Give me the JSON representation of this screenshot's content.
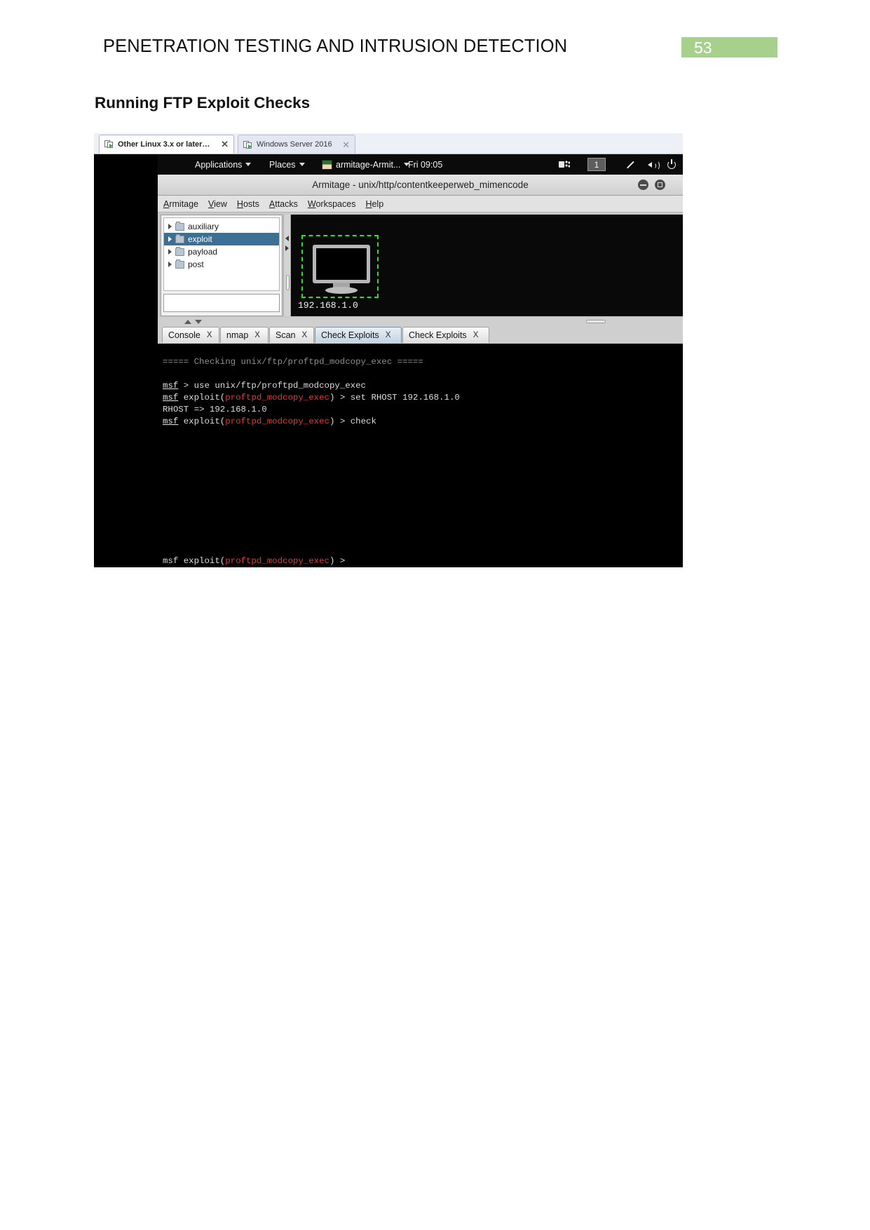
{
  "document": {
    "header_title": "PENETRATION TESTING AND INTRUSION DETECTION",
    "page_number": "53",
    "section_heading": "Running FTP Exploit Checks",
    "badge_color": "#a8d08d"
  },
  "vm_tabs": [
    {
      "label": "Other Linux 3.x or later ke...",
      "close": "✕",
      "active": true
    },
    {
      "label": "Windows Server 2016",
      "close": "✕",
      "active": false
    }
  ],
  "gnome_panel": {
    "applications": "Applications",
    "places": "Places",
    "window_menu": "armitage-Armit...",
    "clock": "Fri 09:05",
    "workspace": "1"
  },
  "armitage": {
    "window_title": "Armitage - unix/http/contentkeeperweb_mimencode",
    "menu": [
      {
        "pre": "",
        "mnemonic": "A",
        "post": "rmitage"
      },
      {
        "pre": "",
        "mnemonic": "V",
        "post": "iew"
      },
      {
        "pre": "",
        "mnemonic": "H",
        "post": "osts"
      },
      {
        "pre": "",
        "mnemonic": "A",
        "post": "ttacks"
      },
      {
        "pre": "",
        "mnemonic": "W",
        "post": "orkspaces"
      },
      {
        "pre": "",
        "mnemonic": "H",
        "post": "elp"
      }
    ],
    "module_tree": [
      {
        "label": "auxiliary",
        "selected": false
      },
      {
        "label": "exploit",
        "selected": true
      },
      {
        "label": "payload",
        "selected": false
      },
      {
        "label": "post",
        "selected": false
      }
    ],
    "module_search_value": "",
    "host": {
      "ip": "192.168.1.0",
      "selected": true
    },
    "console_tabs": [
      {
        "label": "Console",
        "close": "X",
        "active": false
      },
      {
        "label": "nmap",
        "close": "X",
        "active": false
      },
      {
        "label": "Scan",
        "close": "X",
        "active": false
      },
      {
        "label": "Check Exploits",
        "close": "X",
        "active": true
      },
      {
        "label": "Check Exploits",
        "close": "X",
        "active": false
      }
    ],
    "terminal": {
      "banner": "===== Checking unix/ftp/proftpd_modcopy_exec =====",
      "line1_prompt": "msf",
      "line1_rest": " > use unix/ftp/proftpd_modcopy_exec",
      "line2_prompt": "msf",
      "line2_mid": " exploit(",
      "line2_module": "proftpd_modcopy_exec",
      "line2_rest": ") > set RHOST 192.168.1.0",
      "line3": "RHOST => 192.168.1.0",
      "line4_prompt": "msf",
      "line4_mid": " exploit(",
      "line4_module": "proftpd_modcopy_exec",
      "line4_rest": ") > check",
      "bottom_prompt": "msf",
      "bottom_mid": " exploit(",
      "bottom_module": "proftpd_modcopy_exec",
      "bottom_rest": ") > "
    }
  }
}
